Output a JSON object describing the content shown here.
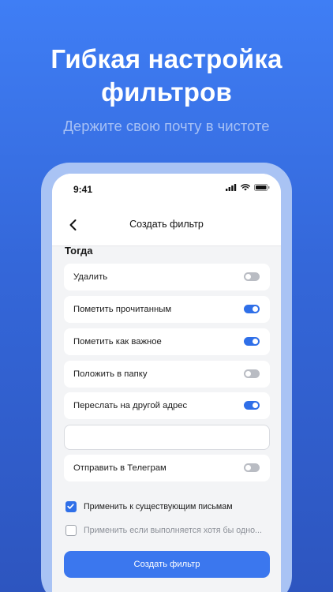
{
  "promo": {
    "title_line1": "Гибкая настройка",
    "title_line2": "фильтров",
    "subtitle": "Держите свою почту в чистоте"
  },
  "status_bar": {
    "time": "9:41"
  },
  "nav": {
    "title": "Создать фильтр"
  },
  "section": {
    "title": "Тогда"
  },
  "actions": [
    {
      "label": "Удалить",
      "enabled": false
    },
    {
      "label": "Пометить прочитанным",
      "enabled": true
    },
    {
      "label": "Пометить как важное",
      "enabled": true
    },
    {
      "label": "Положить в папку",
      "enabled": false
    },
    {
      "label": "Переслать на другой адрес",
      "enabled": true
    },
    {
      "label": "Отправить в Телеграм",
      "enabled": false
    }
  ],
  "forward_address": {
    "value": ""
  },
  "options": [
    {
      "label": "Применить к существующим письмам",
      "checked": true
    },
    {
      "label": "Применить если выполняется хотя бы одно...",
      "checked": false
    }
  ],
  "submit": {
    "label": "Создать фильтр"
  },
  "colors": {
    "accent": "#2f6fe8",
    "background_top": "#3f7ef5",
    "background_bottom": "#2d55bf"
  }
}
